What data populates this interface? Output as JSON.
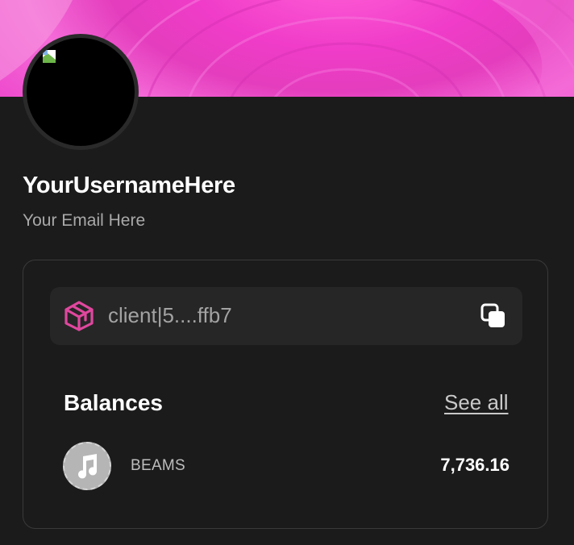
{
  "profile": {
    "username": "YourUsernameHere",
    "email": "Your Email Here"
  },
  "wallet": {
    "address": "client|5....ffb7",
    "address_icon": "cube-icon",
    "copy_icon": "copy-icon"
  },
  "balances": {
    "title": "Balances",
    "see_all_label": "See all",
    "items": [
      {
        "name": "BEAMS",
        "value": "7,736.16",
        "icon": "music-note-icon"
      }
    ]
  },
  "colors": {
    "background": "#1b1b1b",
    "banner_accent": "#f03cc9",
    "address_icon": "#e0479e"
  }
}
